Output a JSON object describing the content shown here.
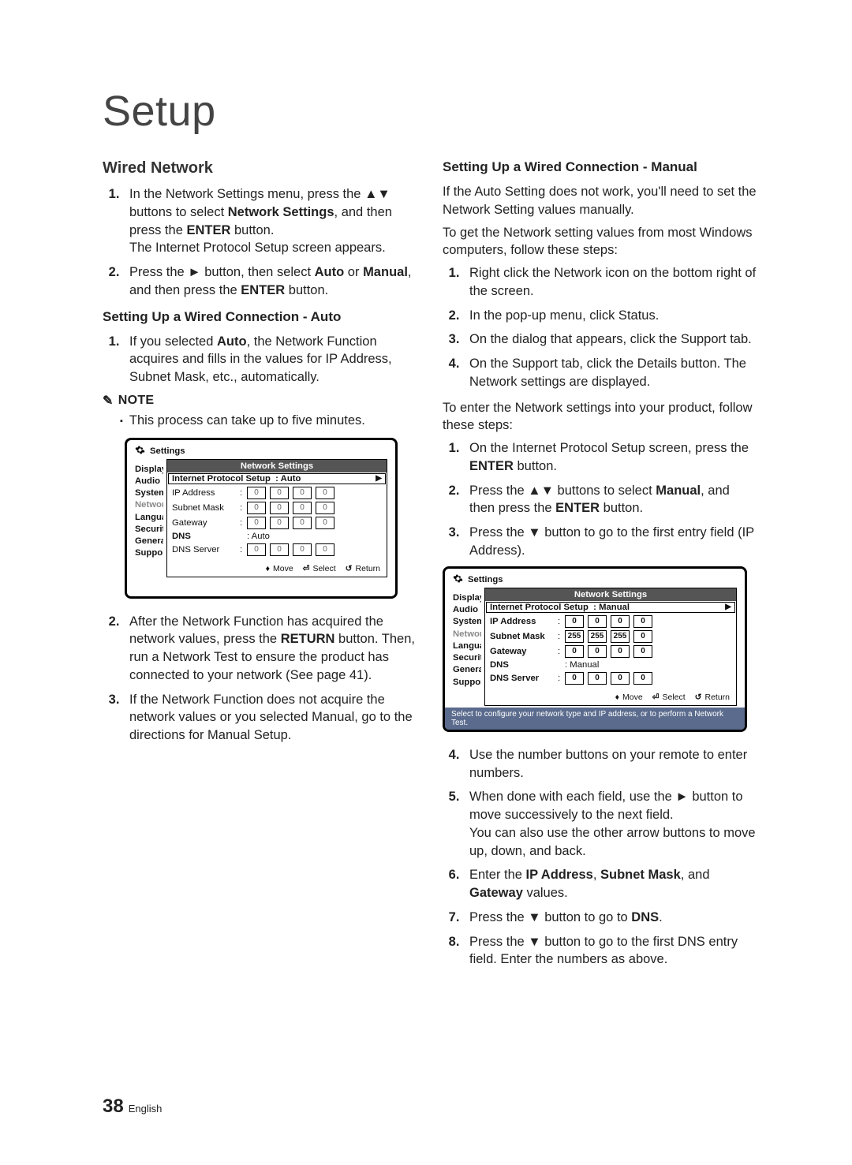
{
  "pageTitle": "Setup",
  "pageNumber": "38",
  "language": "English",
  "left": {
    "heading": "Wired Network",
    "steps1": [
      "In the Network Settings menu, press the ▲▼ buttons to select <b>Network Settings</b>, and then press the <b>ENTER</b> button.<br>The Internet Protocol Setup screen appears.",
      "Press the ► button, then select <b>Auto</b> or <b>Manual</b>, and then press the <b>ENTER</b> button."
    ],
    "subheading": "Setting Up a Wired Connection - Auto",
    "steps2": [
      "If you selected <b>Auto</b>, the Network Function acquires and fills in the values for IP Address, Subnet Mask, etc., automatically."
    ],
    "noteLabel": "NOTE",
    "noteLine": "This process can take up to five minutes.",
    "steps3": [
      "After the Network Function has acquired the network values, press the <b>RETURN</b> button. Then, run a Network Test to ensure the product has connected to your network (See page 41).",
      "If the Network Function does not acquire the network values or you selected Manual, go to the directions for Manual Setup."
    ]
  },
  "right": {
    "subheading": "Setting Up a Wired Connection - Manual",
    "intro1": "If the Auto Setting does not work, you'll need to set the Network Setting values manually.",
    "intro2": "To get the Network setting values from most Windows computers, follow these steps:",
    "stepsA": [
      "Right click the Network icon on the bottom right of the screen.",
      "In the pop-up menu, click Status.",
      "On the dialog that appears, click the Support tab.",
      "On the Support tab, click the Details button. The Network settings are displayed."
    ],
    "mid": "To enter the Network settings into your product, follow these steps:",
    "stepsB": [
      "On the Internet Protocol Setup screen, press the <b>ENTER</b> button.",
      "Press the ▲▼ buttons to select <b>Manual</b>, and then press the <b>ENTER</b> button.",
      "Press the ▼ button to go to the first entry field (IP Address)."
    ],
    "stepsC": [
      "Use the number buttons on your remote to enter numbers.",
      "When done with each field, use the ► button to move successively to the next field.<br>You can also use the other arrow buttons to move up, down, and back.",
      "Enter the <b>IP Address</b>, <b>Subnet Mask</b>, and <b>Gateway</b> values.",
      "Press the ▼ button to go to <b>DNS</b>.",
      "Press the ▼ button to go to the first DNS entry field. Enter the numbers as above."
    ]
  },
  "dialog": {
    "title": "Settings",
    "paneTitle": "Network Settings",
    "protocolLabel": "Internet Protocol Setup",
    "auto": "Auto",
    "manual": "Manual",
    "fields": {
      "ip": "IP Address",
      "subnet": "Subnet Mask",
      "gateway": "Gateway",
      "dns": "DNS",
      "dnsServer": "DNS Server"
    },
    "hints": {
      "move": "Move",
      "select": "Select",
      "return": "Return"
    },
    "status": "Select to configure your network type and IP address, or to perform a Network Test.",
    "tabs": [
      "Display",
      "Audio",
      "System",
      "Network",
      "Language",
      "Security",
      "General",
      "Support"
    ],
    "zeros": [
      "0",
      "0",
      "0",
      "0"
    ],
    "subnetVals": [
      "255",
      "255",
      "255",
      "0"
    ]
  }
}
